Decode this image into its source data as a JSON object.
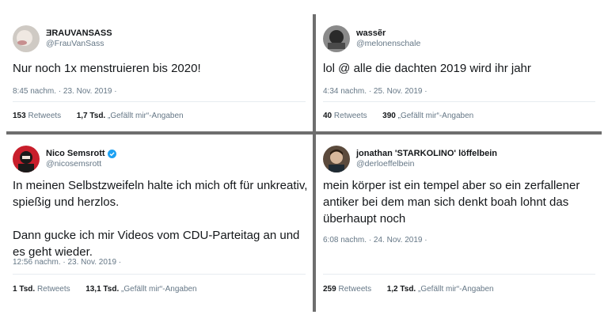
{
  "tweets": [
    {
      "display_name": "ƎRAUVANSASS",
      "handle": "@FrauVanSass",
      "text": "Nur noch 1x menstruieren bis 2020!",
      "time": "8:45 nachm. · 23. Nov. 2019 ·",
      "retweets_count": "153",
      "retweets_label": "Retweets",
      "likes_count": "1,7 Tsd.",
      "likes_label": "„Gefällt mir“-Angaben"
    },
    {
      "display_name": "wassẽr",
      "handle": "@melonenschale",
      "text": "lol @ alle die dachten 2019 wird ihr jahr",
      "time": "4:34 nachm. · 25. Nov. 2019 ·",
      "retweets_count": "40",
      "retweets_label": "Retweets",
      "likes_count": "390",
      "likes_label": "„Gefällt mir“-Angaben"
    },
    {
      "display_name": "Nico Semsrott",
      "handle": "@nicosemsrott",
      "verified": true,
      "text": "In meinen Selbstzweifeln halte ich mich oft für unkreativ, spießig und herzlos.\n\nDann gucke ich mir Videos vom CDU-Parteitag an und es geht wieder.",
      "time": "12:56 nachm. · 23. Nov. 2019 ·",
      "retweets_count": "1 Tsd.",
      "retweets_label": "Retweets",
      "likes_count": "13,1 Tsd.",
      "likes_label": "„Gefällt mir“-Angaben"
    },
    {
      "display_name": "jonathan 'STARKOLINO' löffelbein",
      "handle": "@derloeffelbein",
      "text": "mein körper ist ein tempel aber so ein zerfallener antiker bei dem man sich denkt boah lohnt das überhaupt noch",
      "time": "6:08 nachm. · 24. Nov. 2019 ·",
      "retweets_count": "259",
      "retweets_label": "Retweets",
      "likes_count": "1,2 Tsd.",
      "likes_label": "„Gefällt mir“-Angaben"
    }
  ],
  "colors": {
    "text": "#14171a",
    "meta": "#657786",
    "divider": "#6e6e6e",
    "verified": "#1da1f2"
  }
}
